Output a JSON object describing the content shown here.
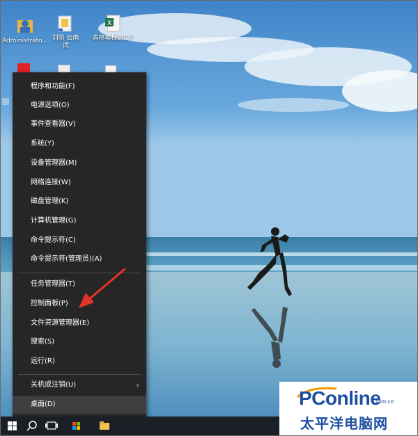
{
  "desktop": {
    "icons": [
      {
        "label": "Administrato...",
        "icon": "user-folder-icon"
      },
      {
        "label": "刘丽·云南\n试",
        "icon": "folder-shortcut-icon"
      },
      {
        "label": "表格模板2027",
        "icon": "excel-file-icon"
      }
    ]
  },
  "context_menu": {
    "items": [
      {
        "label": "程序和功能(F)"
      },
      {
        "label": "电源选项(O)"
      },
      {
        "label": "事件查看器(V)"
      },
      {
        "label": "系统(Y)"
      },
      {
        "label": "设备管理器(M)"
      },
      {
        "label": "网络连接(W)"
      },
      {
        "label": "磁盘管理(K)"
      },
      {
        "label": "计算机管理(G)"
      },
      {
        "label": "命令提示符(C)"
      },
      {
        "label": "命令提示符(管理员)(A)"
      },
      {
        "label": "任务管理器(T)"
      },
      {
        "label": "控制面板(P)"
      },
      {
        "label": "文件资源管理器(E)"
      },
      {
        "label": "搜索(S)"
      },
      {
        "label": "运行(R)"
      },
      {
        "label": "关机或注销(U)",
        "submenu_glyph": "›"
      },
      {
        "label": "桌面(D)"
      }
    ]
  },
  "taskbar": {
    "buttons": [
      "windows-start-icon",
      "search-icon",
      "task-view-icon",
      "store-icon",
      "explorer-icon"
    ]
  },
  "watermark": {
    "brand": "PConline",
    "suffix": ".com.cn",
    "subtitle": "太平洋电脑网"
  },
  "colors": {
    "menu_bg": "#262626",
    "menu_active": "#3f3f3f",
    "arrow": "#e6332a",
    "brand_blue": "#1d4fa2"
  }
}
